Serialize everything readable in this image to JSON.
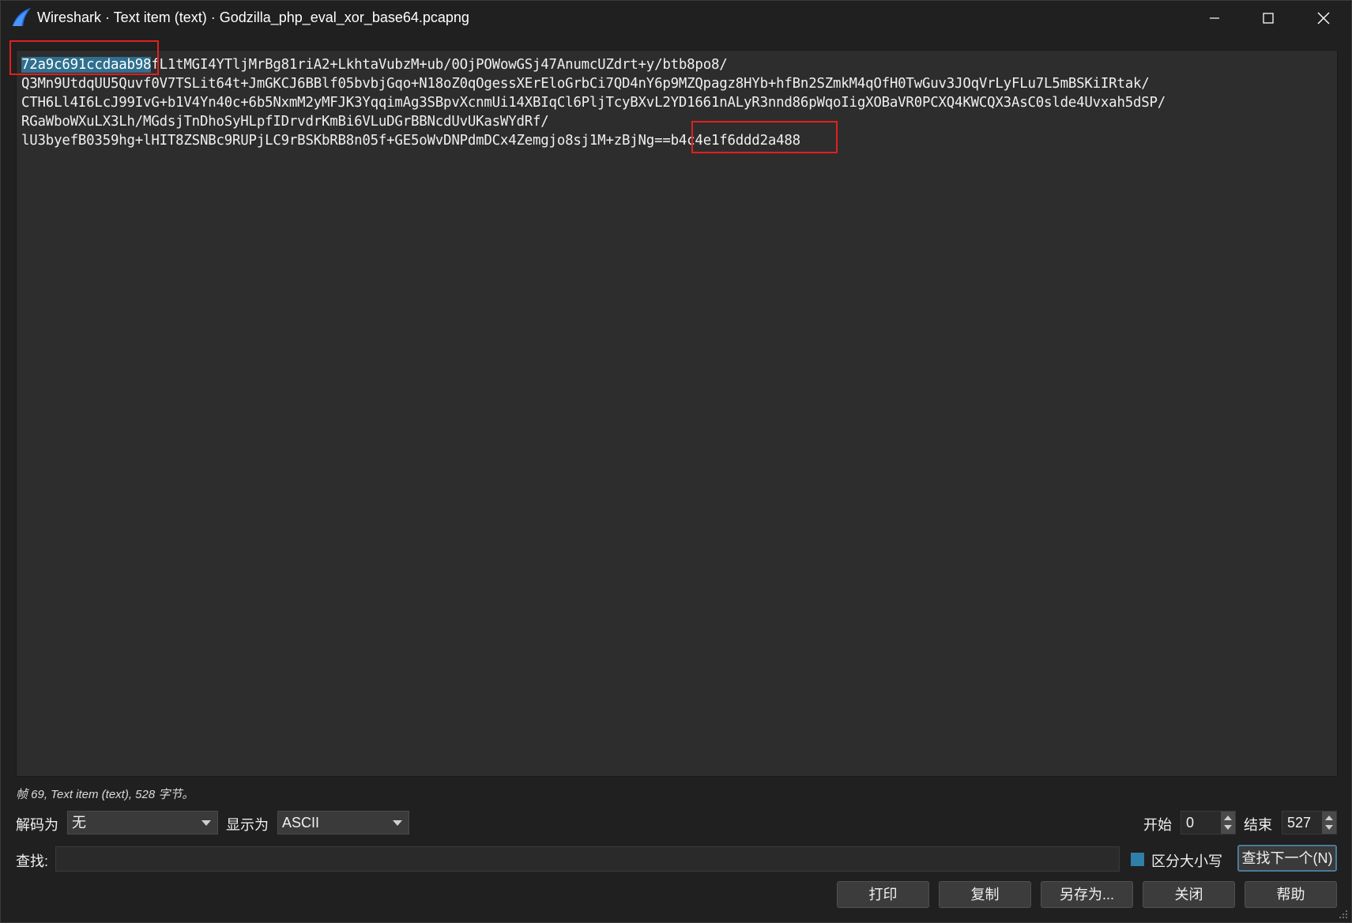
{
  "window": {
    "title": "Wireshark · Text item (text) · Godzilla_php_eval_xor_base64.pcapng"
  },
  "icons": {
    "app": "wireshark-fin-icon",
    "minimize": "minimize-icon",
    "maximize": "maximize-icon",
    "close": "close-icon"
  },
  "content": {
    "selected_prefix": "72a9c691ccdaab98",
    "line1_rest": "fL1tMGI4YTljMrBg81riA2+LkhtaVubzM+ub/0OjPOWowGSj47AnumcUZdrt+y/btb8po8/",
    "line2": "Q3Mn9UtdqUU5Quvf0V7TSLit64t+JmGKCJ6BBlf05bvbjGqo+N18oZ0qOgessXErEloGrbCi7QD4nY6p9MZQpagz8HYb+hfBn2SZmkM4qOfH0TwGuv3JOqVrLyFLu7L5mBSKiIRtak/",
    "line3": "CTH6Ll4I6LcJ99IvG+b1V4Yn40c+6b5NxmM2yMFJK3YqqimAg3SBpvXcnmUi14XBIqCl6PljTcyBXvL2YD1661nALyR3nnd86pWqoIigXOBaVR0PCXQ4KWCQX3AsC0slde4Uvxah5dSP/",
    "line4": "RGaWboWXuLX3Lh/MGdsjTnDhoSyHLpfIDrvdrKmBi6VLuDGrBBNcdUvUKasWYdRf/",
    "line5_main": "lU3byefB0359hg+lHIT8ZSNBc9RUPjLC9rBSKbRB8n05f+GE5oWvDNPdmDCx4Zemgjo8sj1M+zBjNg==",
    "line5_suffix": "b4c4e1f6ddd2a488"
  },
  "status": {
    "text": "帧 69, Text item (text), 528 字节。"
  },
  "controls": {
    "decode_label": "解码为",
    "decode_value": "无",
    "show_label": "显示为",
    "show_value": "ASCII",
    "start_label": "开始",
    "start_value": "0",
    "end_label": "结束",
    "end_value": "527"
  },
  "find": {
    "label": "查找:",
    "value": "",
    "case_label": "区分大小写",
    "case_checked": true,
    "next_label": "查找下一个(N)"
  },
  "buttons": {
    "print": "打印",
    "copy": "复制",
    "save_as": "另存为...",
    "close": "关闭",
    "help": "帮助"
  },
  "colors": {
    "background": "#202020",
    "text_area": "#2d2d2d",
    "selection": "#2f6f8f",
    "highlight_box": "#e0201f",
    "accent": "#2f7fa8"
  }
}
